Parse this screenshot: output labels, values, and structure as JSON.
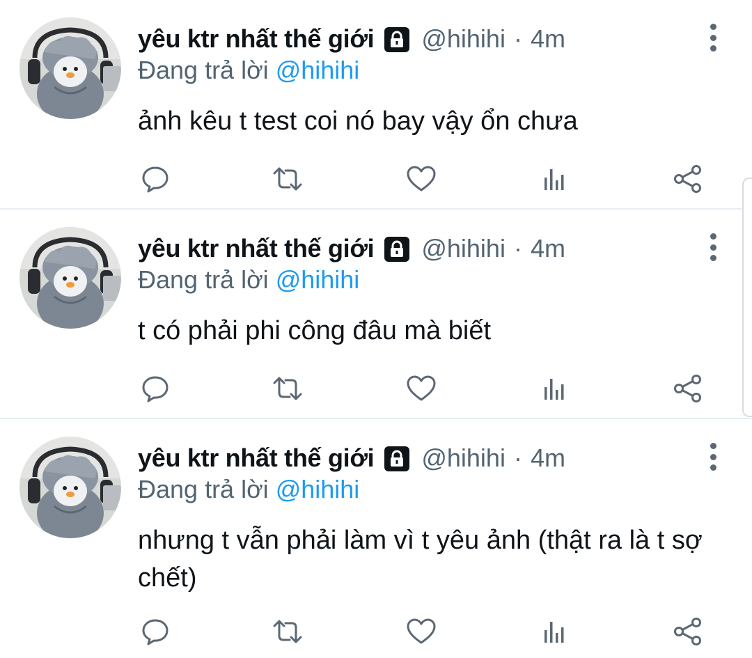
{
  "tweets": [
    {
      "display_name": "yêu ktr nhất thế giới",
      "handle": "@hihihi",
      "separator": "·",
      "time": "4m",
      "reply_prefix": "Đang trả lời",
      "reply_to": "@hihihi",
      "text": "ảnh kêu t test coi nó bay vậy ổn chưa"
    },
    {
      "display_name": "yêu ktr nhất thế giới",
      "handle": "@hihihi",
      "separator": "·",
      "time": "4m",
      "reply_prefix": "Đang trả lời",
      "reply_to": "@hihihi",
      "text": "t có phải phi công đâu mà biết"
    },
    {
      "display_name": "yêu ktr nhất thế giới",
      "handle": "@hihihi",
      "separator": "·",
      "time": "4m",
      "reply_prefix": "Đang trả lời",
      "reply_to": "@hihihi",
      "text": "nhưng t vẫn phải làm vì t yêu ảnh (thật ra là t sợ chết)"
    }
  ],
  "icons": {
    "lock": "lock-icon",
    "more": "more-vertical-icon",
    "reply": "reply-bubble-icon",
    "retweet": "retweet-icon",
    "like": "heart-icon",
    "stats": "analytics-bars-icon",
    "share": "share-icon"
  },
  "colors": {
    "text_primary": "#0f1419",
    "text_secondary": "#536471",
    "link": "#1d9bf0",
    "icon": "#5b6773",
    "divider": "#e6ecf0"
  }
}
